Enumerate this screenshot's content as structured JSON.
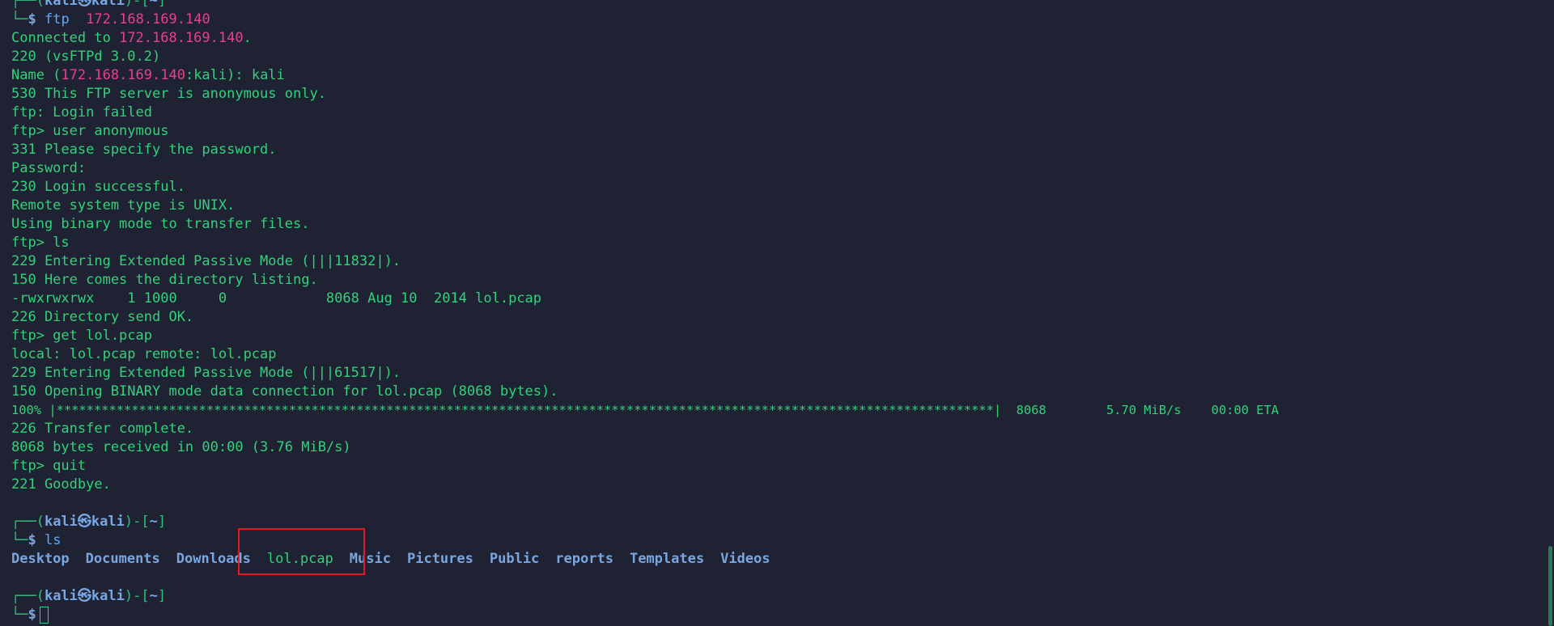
{
  "top_prompt": {
    "frame_top": "┌──(",
    "user": "kali㉿kali",
    "frame_mid": ")-[",
    "path": "~",
    "frame_end": "]"
  },
  "first_command": {
    "frame": "└─",
    "dollar": "$ ",
    "cmd": "ftp",
    "arg": "172.168.169.140"
  },
  "output": {
    "connected_prefix": "Connected to ",
    "connected_ip": "172.168.169.140",
    "connected_suffix": ".",
    "line_220": "220 (vsFTPd 3.0.2)",
    "name_prefix": "Name (",
    "name_ip": "172.168.169.140",
    "name_suffix": ":kali): kali",
    "line_530": "530 This FTP server is anonymous only.",
    "login_failed": "ftp: Login failed",
    "user_anon": "ftp> user anonymous",
    "line_331": "331 Please specify the password.",
    "password": "Password:",
    "line_230": "230 Login successful.",
    "remote_type": "Remote system type is UNIX.",
    "binary_mode": "Using binary mode to transfer files.",
    "ftp_ls": "ftp> ls",
    "line_229a": "229 Entering Extended Passive Mode (|||11832|).",
    "line_150a": "150 Here comes the directory listing.",
    "listing": "-rwxrwxrwx    1 1000     0            8068 Aug 10  2014 lol.pcap",
    "line_226a": "226 Directory send OK.",
    "ftp_get": "ftp> get lol.pcap",
    "local_remote": "local: lol.pcap remote: lol.pcap",
    "line_229b": "229 Entering Extended Passive Mode (|||61517|).",
    "line_150b": "150 Opening BINARY mode data connection for lol.pcap (8068 bytes).",
    "progress": "100% |*****************************************************************************************************************************|  8068        5.70 MiB/s    00:00 ETA",
    "line_226b": "226 Transfer complete.",
    "bytes_received": "8068 bytes received in 00:00 (3.76 MiB/s)",
    "ftp_quit": "ftp> quit",
    "line_221": "221 Goodbye."
  },
  "second_prompt": {
    "frame_top": "┌──(",
    "user": "kali㉿kali",
    "frame_mid": ")-[",
    "path": "~",
    "frame_end": "]",
    "frame_bottom": "└─",
    "dollar": "$ ",
    "cmd": "ls"
  },
  "ls_output": {
    "items": [
      "Desktop",
      "Documents",
      "Downloads",
      "lol.pcap",
      "Music",
      "Pictures",
      "Public",
      "reports",
      "Templates",
      "Videos"
    ]
  },
  "third_prompt": {
    "frame_top": "┌──(",
    "user": "kali㉿kali",
    "frame_mid": ")-[",
    "path": "~",
    "frame_end": "]",
    "frame_bottom": "└─",
    "dollar": "$"
  },
  "colors": {
    "background": "#1e2233",
    "text_green": "#33d17a",
    "ip_pink": "#e9408a",
    "dir_blue": "#7aa6e0",
    "highlight_red": "#e01b24"
  }
}
